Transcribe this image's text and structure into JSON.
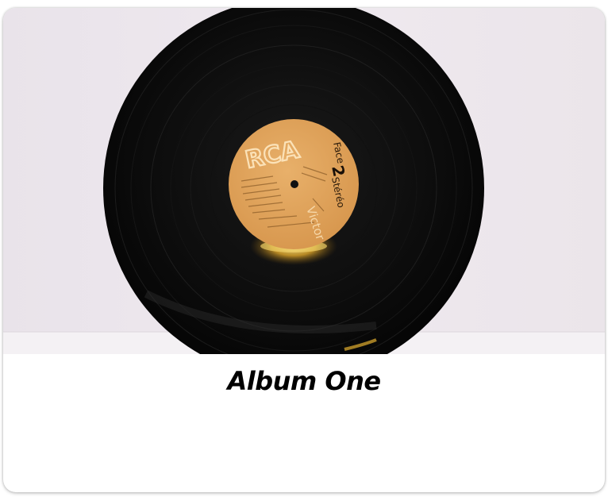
{
  "card": {
    "title": "Album One",
    "image": {
      "subject": "vinyl-record",
      "label_brand": "RCA",
      "label_side_prefix": "Face",
      "label_side_number": "2",
      "label_format": "Stéréo",
      "label_company": "Victor"
    }
  },
  "colors": {
    "wall": "#ece6ec",
    "shelf": "#f3eff3",
    "vinyl": "#0b0b0b",
    "label": "#e0a45c",
    "title": "#000000"
  }
}
